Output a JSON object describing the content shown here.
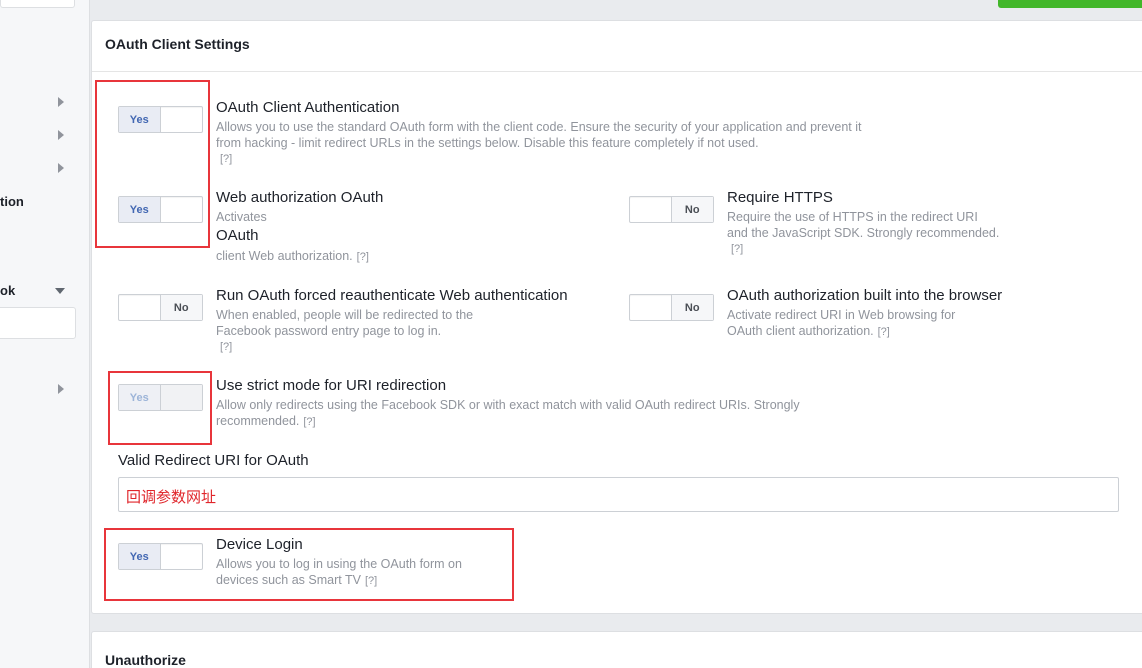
{
  "sidebar": {
    "labels": [
      "tion",
      "ok"
    ]
  },
  "section": {
    "title": "OAuth Client Settings"
  },
  "options": {
    "client_auth": {
      "title": "OAuth Client Authentication",
      "desc": "Allows you to use the standard OAuth form with the client code. Ensure the security of your application and prevent it from hacking - limit redirect URLs in the settings below. Disable this feature completely if not used.",
      "state": "Yes"
    },
    "web_auth": {
      "title": "Web authorization OAuth",
      "desc1": "Activates",
      "title2": "OAuth",
      "desc2": "client Web authorization.",
      "state": "Yes"
    },
    "https": {
      "title": "Require HTTPS",
      "desc": "Require the use of HTTPS in the redirect URI and the JavaScript SDK. Strongly recommended.",
      "state": "No"
    },
    "reauth": {
      "title": "Run OAuth forced reauthenticate Web authentication",
      "desc": "When enabled, people will be redirected to the Facebook password entry page to log in.",
      "state": "No"
    },
    "browser": {
      "title": "OAuth authorization built into the browser",
      "desc": "Activate redirect URI in Web browsing for OAuth client authorization.",
      "state": "No"
    },
    "strict": {
      "title": "Use strict mode for URI redirection",
      "desc": "Allow only redirects using the Facebook SDK or with exact match with valid OAuth redirect URIs. Strongly recommended.",
      "state": "Yes"
    },
    "device": {
      "title": "Device Login",
      "desc": "Allows you to log in using the OAuth form on devices such as Smart TV",
      "state": "Yes"
    }
  },
  "redirect": {
    "label": "Valid Redirect URI for OAuth",
    "value": "回调参数网址"
  },
  "help_mark": "[?]",
  "section2": {
    "title": "Unauthorize"
  },
  "colors": {
    "accent_blue": "#4267b2",
    "annotation_red": "#e8353b",
    "green_button": "#42b72a"
  }
}
